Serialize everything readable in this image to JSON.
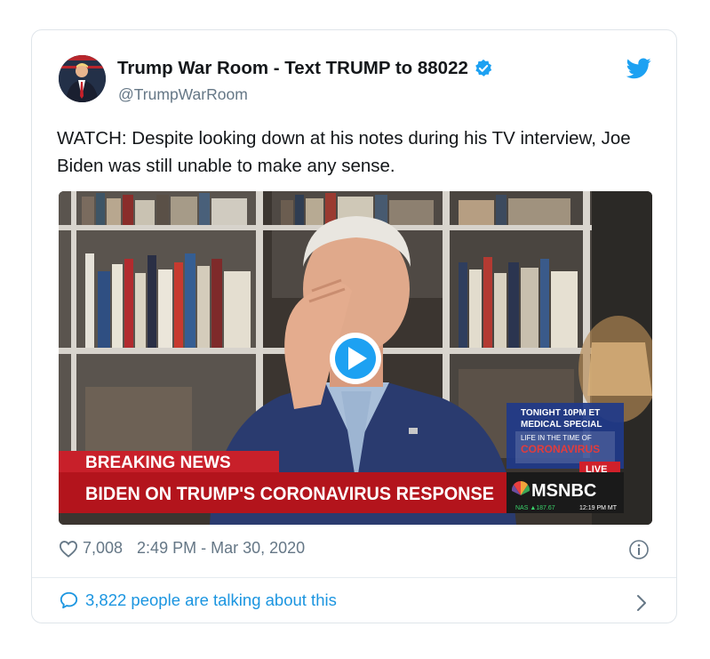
{
  "tweet": {
    "author_name": "Trump War Room - Text TRUMP to 88022",
    "handle": "@TrumpWarRoom",
    "text": "WATCH: Despite looking down at his notes during his TV interview, Joe Biden was still unable to make any sense.",
    "likes": "7,008",
    "timestamp": "2:49 PM - Mar 30, 2020",
    "talking": "3,822 people are talking about this"
  },
  "video": {
    "promo_line1": "TONIGHT 10PM ET",
    "promo_line2": "MEDICAL SPECIAL",
    "promo_line3": "LIFE IN THE TIME OF",
    "promo_line4": "CORONAVIRUS",
    "live": "LIVE",
    "breaking": "BREAKING NEWS",
    "headline": "BIDEN ON TRUMP'S CORONAVIRUS RESPONSE",
    "network": "MSNBC",
    "ticker": "NAS ▲187.67",
    "clock": "12:19 PM MT"
  },
  "icons": {
    "verified": "verified-badge-icon",
    "bird": "twitter-bird-icon",
    "play": "play-icon",
    "heart": "heart-icon",
    "info": "info-icon",
    "bubble": "comment-bubble-icon",
    "chevron": "chevron-right-icon"
  },
  "colors": {
    "twitter_blue": "#1da1f2",
    "link_blue": "#1b95e0",
    "text": "#14171a",
    "muted": "#657786",
    "breaking_red": "#c8202a"
  }
}
